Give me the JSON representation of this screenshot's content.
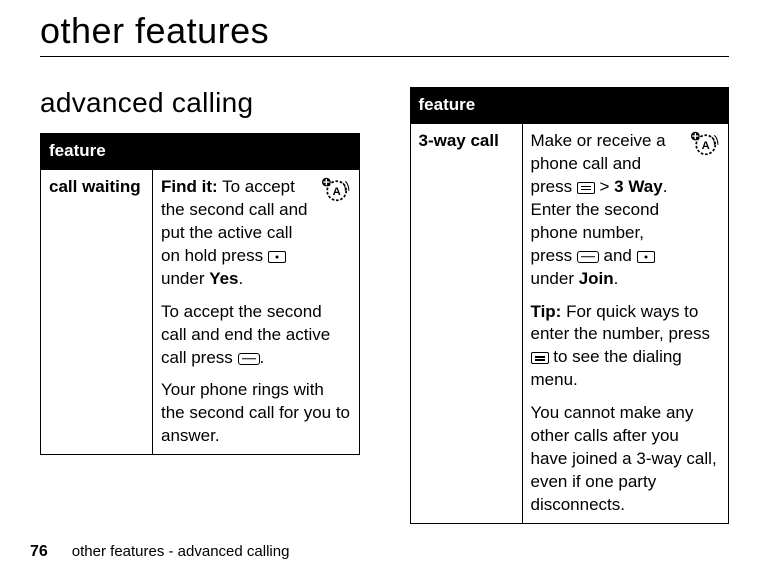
{
  "title": "other features",
  "section_heading": "advanced calling",
  "table_header": "feature",
  "left": {
    "row_label": "call waiting",
    "p1_lead": "Find it:",
    "p1_rest_a": " To accept the second call and put the active call on hold press ",
    "p1_under": " under ",
    "p1_yes": "Yes",
    "p1_end": ".",
    "p2_a": "To accept the second call and end the active call press ",
    "p2_end": ".",
    "p3": "Your phone rings with the second call for you to answer."
  },
  "right": {
    "row_label": "3-way call",
    "p1_a": "Make or receive a phone call and press ",
    "p1_gt": " > ",
    "p1_3way": "3 Way",
    "p1_b": ". Enter the second phone number, press ",
    "p1_and": " and ",
    "p1_under": " under ",
    "p1_join": "Join",
    "p1_end": ".",
    "p2_lead": "Tip:",
    "p2_a": " For quick ways to enter the number, press ",
    "p2_b": " to see the dialing menu.",
    "p3": "You cannot make any other calls after you have joined a 3-way call, even if one party disconnects."
  },
  "footer": {
    "page_number": "76",
    "text": "other features - advanced calling"
  }
}
